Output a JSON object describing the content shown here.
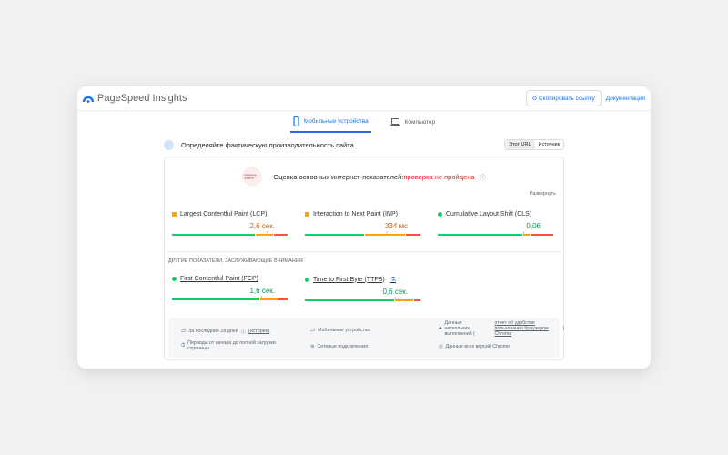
{
  "header": {
    "title": "PageSpeed Insights",
    "copy_link": "Скопировать ссылку",
    "docs": "Документация"
  },
  "tabs": [
    {
      "label": "Мобильные устройства",
      "active": true
    },
    {
      "label": "Компьютер",
      "active": false
    }
  ],
  "section": {
    "title": "Определяйте фактическую производительность сайта",
    "toggle": [
      "Этот URL",
      "Источник"
    ]
  },
  "assessment": {
    "label": "Оценка основных интернет-показателей:",
    "status": "проверка не пройдена",
    "expand": "Развернуть",
    "badge_text": "проверка не пройдена"
  },
  "colors": {
    "good": "#0cce6b",
    "average": "#ffa400",
    "poor": "#ff4e42",
    "accent": "#1a73e8",
    "fail": "#e02020"
  },
  "core_metrics": [
    {
      "name": "Largest Contentful Paint (LCP)",
      "value": "2,6 сек.",
      "rating": "average",
      "distribution": [
        73,
        15,
        12
      ]
    },
    {
      "name": "Interaction to Next Paint (INP)",
      "value": "334 мс",
      "rating": "average",
      "distribution": [
        52,
        35,
        13
      ]
    },
    {
      "name": "Cumulative Layout Shift (CLS)",
      "value": "0,06",
      "rating": "good",
      "distribution": [
        74,
        6,
        20
      ]
    }
  ],
  "other_title": "ДРУГИЕ ПОКАЗАТЕЛИ, ЗАСЛУЖИВАЮЩИЕ ВНИМАНИЯ",
  "other_metrics": [
    {
      "name": "First Contentful Paint (FCP)",
      "value": "1,6 сек.",
      "rating": "good",
      "distribution": [
        77,
        15,
        8
      ]
    },
    {
      "name": "Time to First Byte (TTFB)",
      "value": "0,6 сек.",
      "rating": "good",
      "distribution": [
        78,
        16,
        6
      ],
      "experimental": "⚗"
    }
  ],
  "footer": {
    "period": "За последние 28 дней",
    "history": "(история)",
    "device": "Мобильные устройства",
    "multi": "Данные нескольких выполнений (",
    "report": "отчет об удобстве пользования браузером Chrome",
    "close_paren": ")",
    "durations": "Периоды от начала до полной загрузки страницы",
    "network": "Сетевые подключения",
    "versions": "Данные всех версий Chrome"
  }
}
